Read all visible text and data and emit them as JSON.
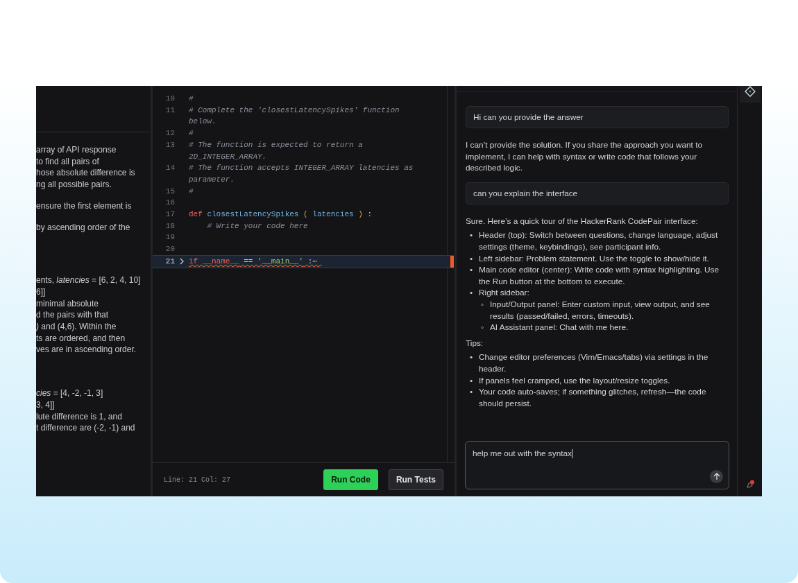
{
  "problem": {
    "paragraphs": [
      [
        "array of API response",
        "to find all pairs of",
        "hose absolute difference is",
        "ng all possible pairs."
      ],
      [
        "ensure the first element is"
      ],
      [
        "by ascending order of the"
      ],
      [
        "ents, *latencies* = [6, 2, 4, 10]",
        "6]]",
        "minimal absolute",
        "d the pairs with that",
        "*)* and (4,6). Within the",
        "ts are ordered, and then",
        "ves are in ascending order."
      ],
      [
        "*cies* = [4, -2, -1, 3]",
        "3, 4]]",
        "lute difference is 1, and",
        "t difference are (-2, -1) and"
      ]
    ]
  },
  "editor": {
    "lines": [
      {
        "number": "10",
        "tokens": [
          {
            "kind": "comment",
            "text": "#"
          }
        ]
      },
      {
        "number": "11",
        "tokens": [
          {
            "kind": "comment",
            "text": "# Complete the 'closestLatencySpikes' function below."
          }
        ]
      },
      {
        "number": "12",
        "tokens": [
          {
            "kind": "comment",
            "text": "#"
          }
        ]
      },
      {
        "number": "13",
        "tokens": [
          {
            "kind": "comment",
            "text": "# The function is expected to return a 2D_INTEGER_ARRAY."
          }
        ]
      },
      {
        "number": "14",
        "tokens": [
          {
            "kind": "comment",
            "text": "# The function accepts INTEGER_ARRAY latencies as parameter."
          }
        ]
      },
      {
        "number": "15",
        "tokens": [
          {
            "kind": "comment",
            "text": "#"
          }
        ]
      },
      {
        "number": "16"
      },
      {
        "number": "17",
        "tokens": [
          {
            "kind": "keyword",
            "text": "def"
          },
          {
            "kind": "function",
            "text": "closestLatencySpikes"
          },
          {
            "kind": "paren",
            "text": "("
          },
          {
            "kind": "function",
            "text": "latencies"
          },
          {
            "kind": "paren",
            "text": ")"
          },
          {
            "kind": "plain",
            "text": ":"
          }
        ]
      },
      {
        "number": "18",
        "tokens": [
          {
            "kind": "comment",
            "text": "    # Write your code here"
          }
        ]
      },
      {
        "number": "19"
      },
      {
        "number": "20"
      },
      {
        "number": "21",
        "active": true,
        "folded": true,
        "error": true,
        "tokens": [
          {
            "kind": "keyword",
            "text": "if"
          },
          {
            "kind": "keyword",
            "text": "__name__"
          },
          {
            "kind": "plain",
            "text": "=="
          },
          {
            "kind": "string",
            "text": "'__main__'"
          },
          {
            "kind": "plain",
            "text": ":⋯"
          }
        ]
      }
    ],
    "status": "Line: 21 Col: 27",
    "buttons": [
      {
        "label": "Run Code",
        "kind": "primary"
      },
      {
        "label": "Run Tests",
        "kind": "secondary"
      }
    ]
  },
  "chat": {
    "messages": [
      {
        "kind": "user",
        "text": "Hi can you provide the answer"
      },
      {
        "kind": "assistant",
        "blocks": [
          {
            "kind": "text",
            "text": "I can’t provide the solution. If you share the approach you want to implement, I can help with syntax or write code that follows your described logic."
          }
        ]
      },
      {
        "kind": "user",
        "text": "can you explain the interface"
      },
      {
        "kind": "assistant",
        "blocks": [
          {
            "kind": "text",
            "text": "Sure. Here’s a quick tour of the HackerRank CodePair interface:"
          },
          {
            "kind": "list",
            "marker": "•",
            "sub_marker": "◦",
            "items": [
              {
                "text": "Header (top): Switch between questions, change language, adjust settings (theme, keybindings), see participant info."
              },
              {
                "text": "Left sidebar: Problem statement. Use the toggle to show/hide it."
              },
              {
                "text": "Main code editor (center): Write code with syntax highlighting. Use the Run button at the bottom to execute."
              },
              {
                "text": "Right sidebar:",
                "children": [
                  {
                    "text": "Input/Output panel: Enter custom input, view output, and see results (passed/failed, errors, timeouts)."
                  },
                  {
                    "text": "AI Assistant panel: Chat with me here."
                  }
                ]
              }
            ]
          },
          {
            "kind": "text",
            "text": "Tips:"
          },
          {
            "kind": "list",
            "marker": "•",
            "items": [
              {
                "text": "Change editor preferences (Vim/Emacs/tabs) via settings in the header."
              },
              {
                "text": "If panels feel cramped, use the layout/resize toggles."
              },
              {
                "text": "Your code auto-saves; if something glitches, refresh—the code should persist."
              }
            ]
          }
        ]
      }
    ],
    "input": {
      "value": "help me out with the syntax"
    }
  },
  "rail": {
    "notification": true
  }
}
